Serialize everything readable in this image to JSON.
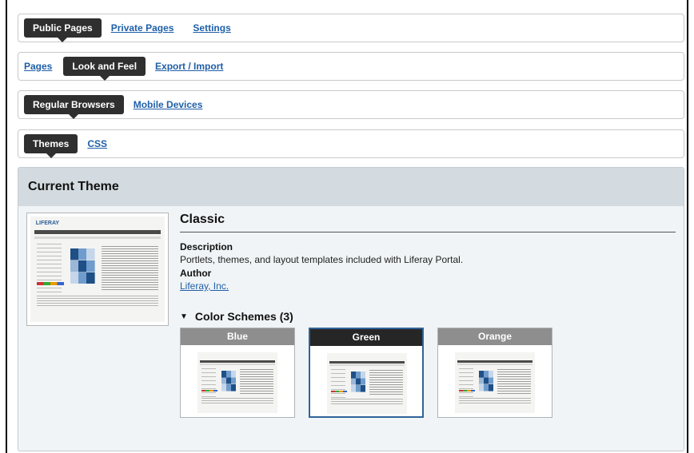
{
  "tabs_level1": {
    "active": "Public Pages",
    "links": [
      "Private Pages",
      "Settings"
    ]
  },
  "tabs_level2": {
    "first_link": "Pages",
    "active": "Look and Feel",
    "links": [
      "Export / Import"
    ]
  },
  "tabs_level3": {
    "active": "Regular Browsers",
    "links": [
      "Mobile Devices"
    ]
  },
  "tabs_level4": {
    "active": "Themes",
    "links": [
      "CSS"
    ]
  },
  "current_theme": {
    "header": "Current Theme",
    "thumbnail_logo": "LIFERAY",
    "name": "Classic",
    "description_label": "Description",
    "description": "Portlets, themes, and layout templates included with Liferay Portal.",
    "author_label": "Author",
    "author": "Liferay, Inc."
  },
  "color_schemes": {
    "heading": "Color Schemes (3)",
    "toggle_icon": "triangle-down-icon",
    "items": [
      {
        "name": "Blue",
        "selected": false
      },
      {
        "name": "Green",
        "selected": true
      },
      {
        "name": "Orange",
        "selected": false
      }
    ]
  },
  "colors": {
    "active_tab": "#2f2f2f",
    "link": "#1f5fa8",
    "panel_header": "#d3dbe0",
    "selected_border": "#2f6499"
  }
}
